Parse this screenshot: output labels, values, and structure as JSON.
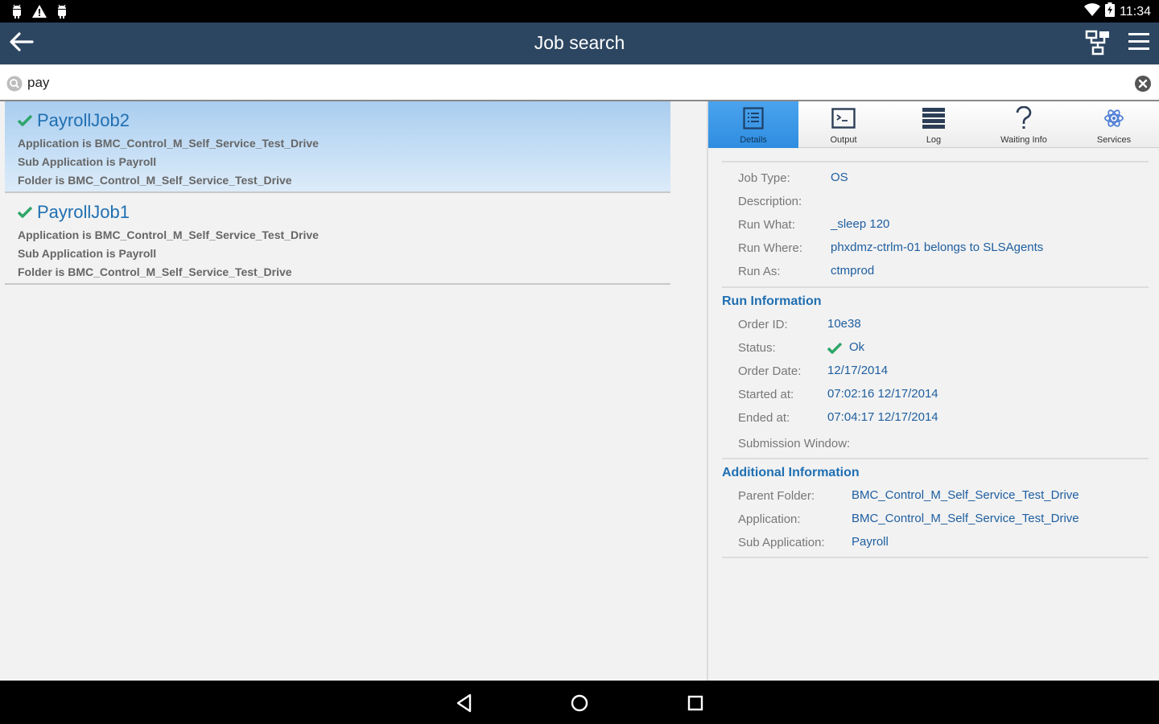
{
  "status_bar": {
    "time": "11:34",
    "left_icons": [
      "android-icon",
      "warning-icon",
      "android-icon"
    ],
    "right_icons": [
      "wifi-icon",
      "battery-charging-icon"
    ]
  },
  "app_bar": {
    "title": "Job search",
    "back_icon": "arrow-left-icon",
    "actions": [
      "hierarchy-icon",
      "menu-icon"
    ]
  },
  "search": {
    "value": "pay",
    "placeholder": ""
  },
  "results": [
    {
      "name": "PayrollJob2",
      "selected": true,
      "status_icon": "check-icon",
      "lines": [
        "Application is BMC_Control_M_Self_Service_Test_Drive",
        "Sub Application is Payroll",
        "Folder is BMC_Control_M_Self_Service_Test_Drive"
      ]
    },
    {
      "name": "PayrollJob1",
      "selected": false,
      "status_icon": "check-icon",
      "lines": [
        "Application is BMC_Control_M_Self_Service_Test_Drive",
        "Sub Application is Payroll",
        "Folder is BMC_Control_M_Self_Service_Test_Drive"
      ]
    }
  ],
  "tabs": [
    {
      "label": "Details",
      "icon": "list-document-icon",
      "active": true
    },
    {
      "label": "Output",
      "icon": "terminal-icon",
      "active": false
    },
    {
      "label": "Log",
      "icon": "log-lines-icon",
      "active": false
    },
    {
      "label": "Waiting Info",
      "icon": "question-icon",
      "active": false
    },
    {
      "label": "Services",
      "icon": "atom-icon",
      "active": false
    }
  ],
  "details": {
    "general": [
      {
        "label": "Job Type:",
        "value": "OS"
      },
      {
        "label": "Description:",
        "value": ""
      },
      {
        "label": "Run What:",
        "value": "_sleep 120"
      },
      {
        "label": "Run Where:",
        "value": "phxdmz-ctrlm-01 belongs to SLSAgents"
      },
      {
        "label": "Run As:",
        "value": "ctmprod"
      }
    ],
    "run_info_title": "Run Information",
    "run_info": [
      {
        "label": "Order ID:",
        "value": "10e38"
      },
      {
        "label": "Status:",
        "value": "Ok",
        "icon": "check-icon"
      },
      {
        "label": "Order Date:",
        "value": "12/17/2014"
      },
      {
        "label": "Started at:",
        "value": "07:02:16 12/17/2014"
      },
      {
        "label": "Ended at:",
        "value": "07:04:17 12/17/2014"
      },
      {
        "label": "Submission Window:",
        "value": ""
      }
    ],
    "additional_title": "Additional Information",
    "additional": [
      {
        "label": "Parent Folder:",
        "value": "BMC_Control_M_Self_Service_Test_Drive"
      },
      {
        "label": "Application:",
        "value": "BMC_Control_M_Self_Service_Test_Drive"
      },
      {
        "label": "Sub Application:",
        "value": "Payroll"
      }
    ]
  },
  "nav_bar": [
    "back-triangle-icon",
    "home-circle-icon",
    "recents-square-icon"
  ],
  "colors": {
    "app_bar": "#2c4661",
    "accent_blue": "#1f6fb2",
    "value_blue": "#1f5fa0",
    "tab_active": "#3b97e8",
    "check_green": "#2fa66a"
  }
}
